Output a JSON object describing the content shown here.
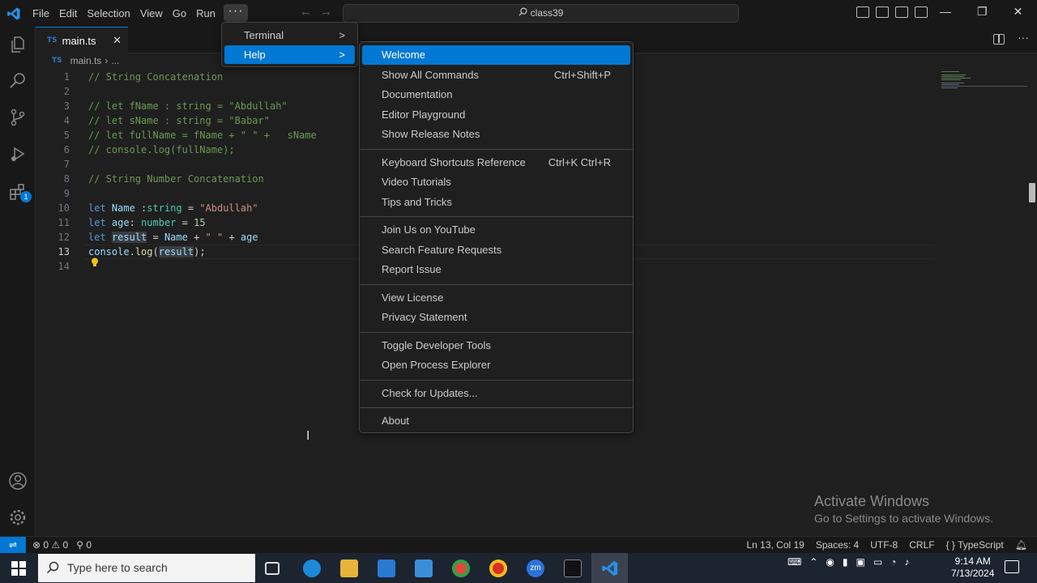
{
  "titlebar": {
    "menus": [
      "File",
      "Edit",
      "Selection",
      "View",
      "Go",
      "Run"
    ],
    "more": "···",
    "command_center": "class39"
  },
  "tab": {
    "icon_text": "TS",
    "label": "main.ts",
    "close": "✕"
  },
  "breadcrumb": {
    "icon_text": "TS",
    "file": "main.ts",
    "sep": "›",
    "rest": "..."
  },
  "editor": {
    "lines": [
      {
        "n": "1",
        "segs": [
          [
            "c-com",
            "// String Concatenation"
          ]
        ]
      },
      {
        "n": "2",
        "segs": []
      },
      {
        "n": "3",
        "segs": [
          [
            "c-com",
            "// let fName : string = \"Abdullah\""
          ]
        ]
      },
      {
        "n": "4",
        "segs": [
          [
            "c-com",
            "// let sName : string = \"Babar\""
          ]
        ]
      },
      {
        "n": "5",
        "segs": [
          [
            "c-com",
            "// let fullName = fName + \" \" +   sName"
          ]
        ]
      },
      {
        "n": "6",
        "segs": [
          [
            "c-com",
            "// console.log(fullName);"
          ]
        ]
      },
      {
        "n": "7",
        "segs": []
      },
      {
        "n": "8",
        "segs": [
          [
            "c-com",
            "// String Number Concatenation"
          ]
        ]
      },
      {
        "n": "9",
        "segs": []
      },
      {
        "n": "10",
        "segs": [
          [
            "c-kw",
            "let "
          ],
          [
            "c-var",
            "Name "
          ],
          [
            "c-pl",
            ":"
          ],
          [
            "c-type",
            "string"
          ],
          [
            "c-pl",
            " = "
          ],
          [
            "c-str",
            "\"Abdullah\""
          ]
        ]
      },
      {
        "n": "11",
        "segs": [
          [
            "c-kw",
            "let "
          ],
          [
            "c-var",
            "age"
          ],
          [
            "c-pl",
            ": "
          ],
          [
            "c-type",
            "number"
          ],
          [
            "c-pl",
            " = "
          ],
          [
            "c-num",
            "15"
          ]
        ]
      },
      {
        "n": "12",
        "segs": [
          [
            "c-kw",
            "let "
          ],
          [
            "c-var hl",
            "result"
          ],
          [
            "c-pl",
            " = "
          ],
          [
            "c-var",
            "Name"
          ],
          [
            "c-pl",
            " + "
          ],
          [
            "c-str",
            "\" \""
          ],
          [
            "c-pl",
            " + "
          ],
          [
            "c-var",
            "age"
          ]
        ]
      },
      {
        "n": "13",
        "segs": [
          [
            "c-var",
            "console"
          ],
          [
            "c-pl",
            "."
          ],
          [
            "c-fn",
            "log"
          ],
          [
            "c-pl",
            "("
          ],
          [
            "c-var hl",
            "result"
          ],
          [
            "c-pl",
            ");"
          ]
        ]
      },
      {
        "n": "14",
        "segs": []
      }
    ],
    "current_line": "13"
  },
  "menu_run": {
    "items": [
      {
        "label": "Terminal",
        "arrow": ">"
      },
      {
        "label": "Help",
        "arrow": ">"
      }
    ]
  },
  "menu_help": {
    "items": [
      {
        "label": "Welcome",
        "shortcut": ""
      },
      {
        "label": "Show All Commands",
        "shortcut": "Ctrl+Shift+P"
      },
      {
        "label": "Documentation",
        "shortcut": ""
      },
      {
        "label": "Editor Playground",
        "shortcut": ""
      },
      {
        "label": "Show Release Notes",
        "shortcut": ""
      },
      {
        "label": "Keyboard Shortcuts Reference",
        "shortcut": "Ctrl+K Ctrl+R"
      },
      {
        "label": "Video Tutorials",
        "shortcut": ""
      },
      {
        "label": "Tips and Tricks",
        "shortcut": ""
      },
      {
        "label": "Join Us on YouTube",
        "shortcut": ""
      },
      {
        "label": "Search Feature Requests",
        "shortcut": ""
      },
      {
        "label": "Report Issue",
        "shortcut": ""
      },
      {
        "label": "View License",
        "shortcut": ""
      },
      {
        "label": "Privacy Statement",
        "shortcut": ""
      },
      {
        "label": "Toggle Developer Tools",
        "shortcut": ""
      },
      {
        "label": "Open Process Explorer",
        "shortcut": ""
      },
      {
        "label": "Check for Updates...",
        "shortcut": ""
      },
      {
        "label": "About",
        "shortcut": ""
      }
    ]
  },
  "watermark": {
    "line1": "Activate Windows",
    "line2": "Go to Settings to activate Windows."
  },
  "statusbar": {
    "errors": "0",
    "warnings": "0",
    "ports": "0",
    "position": "Ln 13, Col 19",
    "spaces": "Spaces: 4",
    "encoding": "UTF-8",
    "eol": "CRLF",
    "language": "TypeScript",
    "language_prefix": "{ }"
  },
  "taskbar": {
    "search_placeholder": "Type here to search",
    "time": "9:14 AM",
    "date": "7/13/2024"
  },
  "colors": {
    "accent": "#0078d4",
    "bg": "#1f1f1f",
    "taskbar": "#1c2430"
  }
}
